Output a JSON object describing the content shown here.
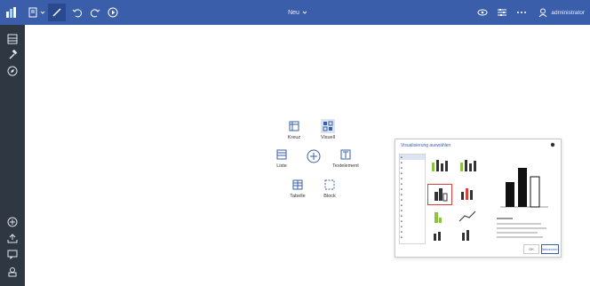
{
  "topbar": {
    "title": "Neu",
    "user_label": "administrator"
  },
  "insert_menu": {
    "items": [
      {
        "label": "Kreuz"
      },
      {
        "label": "Visuell"
      },
      {
        "label": "Liste"
      },
      {
        "label": "Textelement"
      },
      {
        "label": "Tabelle"
      },
      {
        "label": "Block"
      }
    ]
  },
  "dialog": {
    "title": "Visualisierung auswählen",
    "buttons": [
      "OK",
      "Abbrechen"
    ]
  },
  "colors": {
    "topbar": "#3b5eab",
    "sidebar": "#2e3742",
    "accent": "#d9443a",
    "green": "#8bc53f"
  }
}
